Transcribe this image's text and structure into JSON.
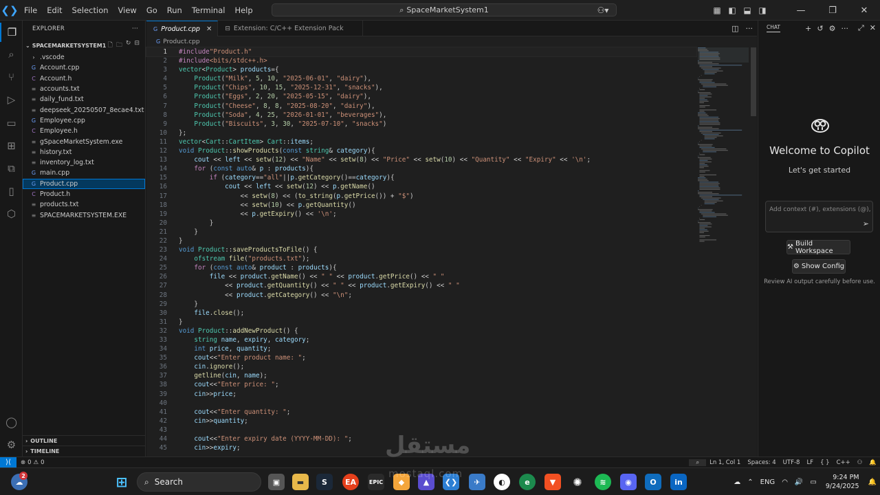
{
  "menu": [
    "File",
    "Edit",
    "Selection",
    "View",
    "Go",
    "Run",
    "Terminal",
    "Help"
  ],
  "command_center": "SpaceMarketSystem1",
  "explorer": {
    "title": "EXPLORER",
    "folder": "SPACEMARKETSYSTEM1",
    "files": [
      {
        "name": ".vscode",
        "type": "folder"
      },
      {
        "name": "Account.cpp",
        "type": "cpp"
      },
      {
        "name": "Account.h",
        "type": "h"
      },
      {
        "name": "accounts.txt",
        "type": "txt"
      },
      {
        "name": "daily_fund.txt",
        "type": "txt"
      },
      {
        "name": "deepseek_20250507_8ecae4.txt",
        "type": "txt"
      },
      {
        "name": "Employee.cpp",
        "type": "cpp"
      },
      {
        "name": "Employee.h",
        "type": "h"
      },
      {
        "name": "gSpaceMarketSystem.exe",
        "type": "exe"
      },
      {
        "name": "history.txt",
        "type": "txt"
      },
      {
        "name": "inventory_log.txt",
        "type": "txt"
      },
      {
        "name": "main.cpp",
        "type": "cpp"
      },
      {
        "name": "Product.cpp",
        "type": "cpp",
        "selected": true
      },
      {
        "name": "Product.h",
        "type": "h"
      },
      {
        "name": "products.txt",
        "type": "txt"
      },
      {
        "name": "SPACEMARKETSYSTEM.EXE",
        "type": "exe"
      }
    ],
    "outline": "OUTLINE",
    "timeline": "TIMELINE"
  },
  "tabs": [
    {
      "label": "Product.cpp",
      "active": true
    },
    {
      "label": "Extension: C/C++ Extension Pack",
      "active": false
    }
  ],
  "breadcrumb": "Product.cpp",
  "code": [
    "#include\"Product.h\"",
    "#include<bits/stdc++.h>",
    "vector<Product> products={",
    "    Product(\"Milk\", 5, 10, \"2025-06-01\", \"dairy\"),",
    "    Product(\"Chips\", 10, 15, \"2025-12-31\", \"snacks\"),",
    "    Product(\"Eggs\", 2, 20, \"2025-05-15\", \"dairy\"),",
    "    Product(\"Cheese\", 8, 8, \"2025-08-20\", \"dairy\"),",
    "    Product(\"Soda\", 4, 25, \"2026-01-01\", \"beverages\"),",
    "    Product(\"Biscuits\", 3, 30, \"2025-07-10\", \"snacks\")",
    "};",
    "vector<Cart::CartItem> Cart::items;",
    "void Product::showProducts(const string& category){",
    "    cout << left << setw(12) << \"Name\" << setw(8) << \"Price\" << setw(10) << \"Quantity\" << \"Expiry\" << '\\n';",
    "    for (const auto& p : products){",
    "        if (category==\"all\"||p.getCategory()==category){",
    "            cout << left << setw(12) << p.getName()",
    "                << setw(8) << (to_string(p.getPrice()) + \"$\")",
    "                << setw(10) << p.getQuantity()",
    "                << p.getExpiry() << '\\n';",
    "        }",
    "    }",
    "}",
    "void Product::saveProductsToFile() {",
    "    ofstream file(\"products.txt\");",
    "    for (const auto& product : products){",
    "        file << product.getName() << \" \" << product.getPrice() << \" \"",
    "            << product.getQuantity() << \" \" << product.getExpiry() << \" \"",
    "            << product.getCategory() << \"\\n\";",
    "    }",
    "    file.close();",
    "}",
    "void Product::addNewProduct() {",
    "    string name, expiry, category;",
    "    int price, quantity;",
    "    cout<<\"Enter product name: \";",
    "    cin.ignore();",
    "    getline(cin, name);",
    "    cout<<\"Enter price: \";",
    "    cin>>price;",
    "",
    "    cout<<\"Enter quantity: \";",
    "    cin>>quantity;",
    "",
    "    cout<<\"Enter expiry date (YYYY-MM-DD): \";",
    "    cin>>expiry;"
  ],
  "chat": {
    "title": "CHAT",
    "welcome": "Welcome to Copilot",
    "subtitle": "Let's get started",
    "input_placeholder": "Add context (#), extensions (@), commands",
    "build_workspace": "Build Workspace",
    "show_config": "Show Config",
    "review": "Review AI output carefully before use."
  },
  "status": {
    "problems": "0",
    "warnings": "0",
    "position": "Ln 1, Col 1",
    "spaces": "Spaces: 4",
    "encoding": "UTF-8",
    "eol": "LF",
    "language": "C++"
  },
  "taskbar": {
    "search": "Search",
    "lang": "ENG",
    "time": "9:24 PM",
    "date": "9/24/2025",
    "weather_badge": "2"
  },
  "watermark": {
    "text": "مستقل",
    "sub": "mostaql.com"
  },
  "colors": {
    "accent": "#0078d4",
    "keyword": "#569cd6",
    "string": "#ce9178",
    "type": "#4ec9b0",
    "func": "#dcdcaa",
    "var": "#9cdcfe",
    "preproc": "#c586c0"
  }
}
